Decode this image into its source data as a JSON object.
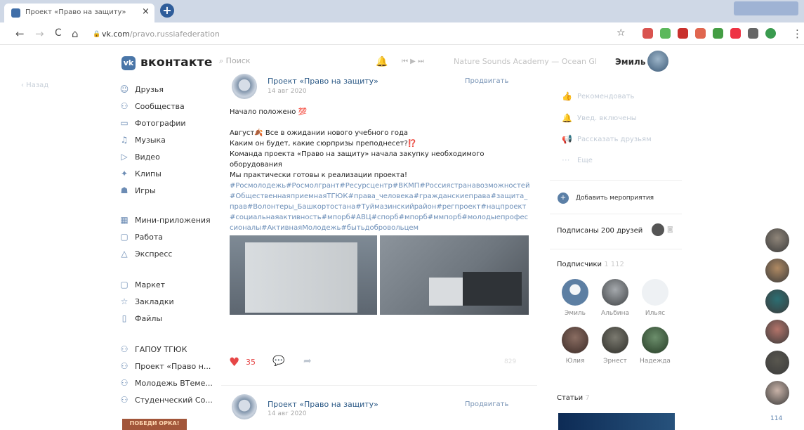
{
  "browser": {
    "tab_title": "Проект «Право на защиту»",
    "tab_close": "×",
    "new_tab": "+",
    "back": "←",
    "forward": "→",
    "reload": "C",
    "home": "⌂",
    "url_domain": "vk.com",
    "url_path": "/pravo.russiafederation",
    "bookmark": "☆",
    "menu": "⋮",
    "ext_colors": [
      "#d9534f",
      "#5cb85c",
      "#c9302c",
      "#e0664f",
      "#449d44",
      "#ee3344",
      "#666666",
      "#3a9b4f"
    ]
  },
  "header": {
    "logo_letter": "vk",
    "logo_text": "вконтакте",
    "search_placeholder": "Поиск",
    "track": "Nature Sounds Academy — Ocean Gl",
    "user_name": "Эмиль",
    "player_controls": "⏮  ▶  ⏭"
  },
  "left_back": "‹ Назад",
  "menu": {
    "items": [
      {
        "icon": "people-icon",
        "glyph": "☺",
        "label": "Друзья"
      },
      {
        "icon": "groups-icon",
        "glyph": "⚇",
        "label": "Сообщества"
      },
      {
        "icon": "photo-icon",
        "glyph": "▭",
        "label": "Фотографии"
      },
      {
        "icon": "music-icon",
        "glyph": "♫",
        "label": "Музыка"
      },
      {
        "icon": "video-icon",
        "glyph": "▷",
        "label": "Видео"
      },
      {
        "icon": "clips-icon",
        "glyph": "✦",
        "label": "Клипы"
      },
      {
        "icon": "games-icon",
        "glyph": "☗",
        "label": "Игры"
      },
      {
        "icon": "apps-icon",
        "glyph": "▦",
        "label": "Мини-приложения"
      },
      {
        "icon": "work-icon",
        "glyph": "▢",
        "label": "Работа"
      },
      {
        "icon": "express-icon",
        "glyph": "△",
        "label": "Экспресс"
      },
      {
        "icon": "market-icon",
        "glyph": "▢",
        "label": "Маркет"
      },
      {
        "icon": "bookmarks-icon",
        "glyph": "☆",
        "label": "Закладки"
      },
      {
        "icon": "files-icon",
        "glyph": "▯",
        "label": "Файлы"
      },
      {
        "icon": "group-icon",
        "glyph": "⚇",
        "label": "ГАПОУ ТГЮК"
      },
      {
        "icon": "group-icon",
        "glyph": "⚇",
        "label": "Проект «Право н..."
      },
      {
        "icon": "group-icon",
        "glyph": "⚇",
        "label": "Молодежь ВТеме..."
      },
      {
        "icon": "group-icon",
        "glyph": "⚇",
        "label": "Студенческий Со..."
      }
    ],
    "promo": "ПОБЕДИ ОРКА!"
  },
  "post": {
    "author": "Проект «Право на защиту»",
    "date": "14 авг 2020",
    "promote": "Продвигать",
    "intro": "Начало положено 💯",
    "line1": "Август🍂 Все в ожидании нового учебного года",
    "line2": "Каким он будет, какие сюрпризы преподнесет?⁉️",
    "line3": "Команда проекта «Право на защиту» начала закупку необходимого оборудования",
    "line4": "Мы практически готовы к реализации проекта!",
    "tags": "#Росмолодежь#Росмолгрант#Ресурсцентр#ВКМП#Россиястранавозможностей#ОбщественнаяприемнаяТГЮК#права_человека#гражданскиеправа#защита_прав#Волонтеры_Башкортостана#Туймазинскийрайон#регпроект#нацпроект#социальнаяактивность#мпорб#АВЦ#спорб#мпорб#ммпорб#молодыепрофессионалы#АктивнаяМолодежь#бытьдобровольцем",
    "likes": "35",
    "views": "829"
  },
  "post2": {
    "author": "Проект «Право на защиту»",
    "date": "14 авг 2020",
    "promote": "Продвигать"
  },
  "right": {
    "recommend": "Рекомендовать",
    "notify": "Увед. включены",
    "tell": "Рассказать друзьям",
    "more": "Еще",
    "add_event": "Добавить мероприятия",
    "friends": "Подписаны 200 друзей",
    "subscribers": "Подписчики",
    "subscribers_count": "1 112",
    "subs": [
      "Эмиль",
      "Альбина",
      "Ильяс",
      "Юлия",
      "Эрнест",
      "Надежда"
    ],
    "articles": "Статьи",
    "articles_count": "7",
    "online_count": "114"
  }
}
